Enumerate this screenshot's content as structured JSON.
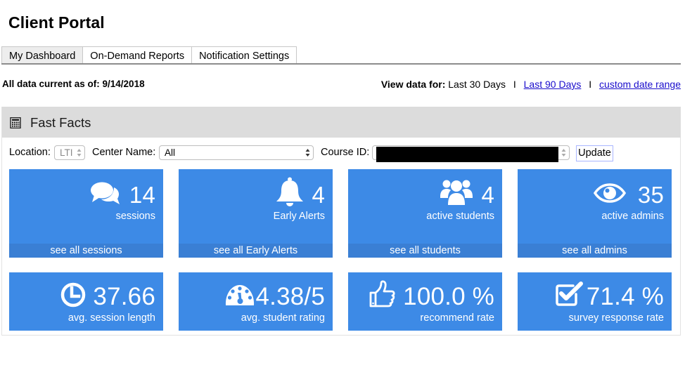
{
  "header": {
    "title": "Client Portal"
  },
  "tabs": [
    {
      "label": "My Dashboard",
      "active": true
    },
    {
      "label": "On-Demand Reports",
      "active": false
    },
    {
      "label": "Notification Settings",
      "active": false
    }
  ],
  "status": {
    "as_of": "All data current as of: 9/14/2018",
    "view_label": "View data for:",
    "current_range": "Last 30 Days",
    "separator": "I",
    "link_90": "Last 90 Days",
    "link_custom": "custom date range"
  },
  "panel": {
    "title": "Fast Facts",
    "icon": "calculator-icon",
    "filters": {
      "location_label": "Location:",
      "location_value": "LTI",
      "center_label": "Center Name:",
      "center_value": "All",
      "course_label": "Course ID:",
      "course_value": "[redacted]",
      "update_label": "Update"
    }
  },
  "tiles": [
    {
      "icon": "comments-icon",
      "value": "14",
      "label": "sessions",
      "link": "see all sessions"
    },
    {
      "icon": "bell-icon",
      "value": "4",
      "label": "Early Alerts",
      "link": "see all Early Alerts"
    },
    {
      "icon": "users-icon",
      "value": "4",
      "label": "active students",
      "link": "see all students"
    },
    {
      "icon": "eye-icon",
      "value": "35",
      "label": "active admins",
      "link": "see all admins"
    },
    {
      "icon": "clock-icon",
      "value": "37.66",
      "label": "avg. session length"
    },
    {
      "icon": "dashboard-gauge-icon",
      "value": "4.38/5",
      "label": "avg. student rating"
    },
    {
      "icon": "thumbs-up-icon",
      "value": "100.0 %",
      "label": "recommend rate"
    },
    {
      "icon": "check-square-icon",
      "value": "71.4 %",
      "label": "survey response rate"
    }
  ],
  "colors": {
    "tile_bg": "#3d8ae6",
    "tile_footer": "#3a7fd4",
    "link": "#1a0dcc",
    "panel_header": "#dcdcdc"
  }
}
